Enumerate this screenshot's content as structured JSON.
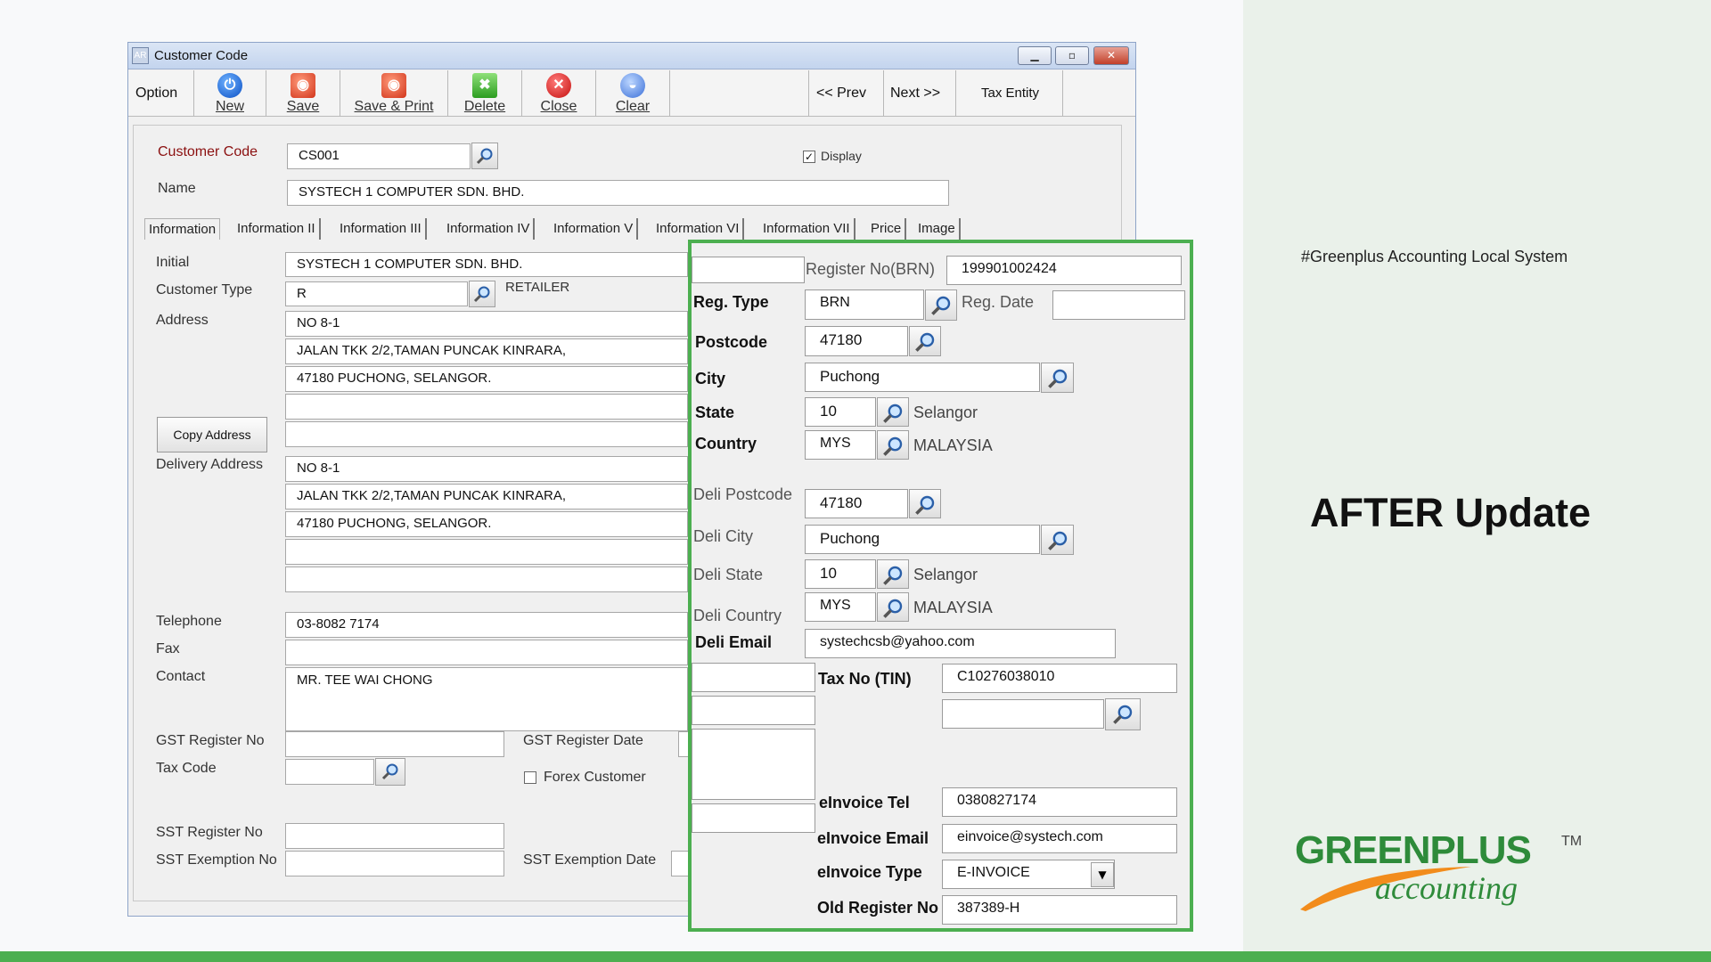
{
  "slide": {
    "hashtag": "#Greenplus Accounting Local System",
    "heading": "AFTER Update",
    "logo_main": "GREENPLUS",
    "logo_tm": "TM",
    "logo_sub": "accounting",
    "colors": {
      "accent": "#4caf50",
      "logo": "#2e8b3a",
      "panel": "#eaf1ea"
    }
  },
  "window": {
    "title": "Customer Code",
    "icon_text": "AR",
    "controls": [
      "minimize-icon",
      "maximize-icon",
      "close-icon"
    ]
  },
  "toolbar": {
    "option": "Option",
    "new": "New",
    "save": "Save",
    "save_print": "Save & Print",
    "delete": "Delete",
    "close": "Close",
    "clear": "Clear",
    "prev": "<<  Prev",
    "next": "Next  >>",
    "tax_entity": "Tax Entity"
  },
  "header": {
    "customer_code_label": "Customer Code",
    "customer_code": "CS001",
    "display_label": "Display",
    "display_checked": "✓",
    "name_label": "Name",
    "name": "SYSTECH 1 COMPUTER SDN. BHD."
  },
  "tabs": [
    "Information",
    "Information II",
    "Information III",
    "Information IV",
    "Information V",
    "Information VI",
    "Information VII",
    "Price",
    "Image"
  ],
  "info": {
    "initial_label": "Initial",
    "initial": "SYSTECH 1 COMPUTER SDN. BHD.",
    "customer_type_label": "Customer Type",
    "customer_type": "R",
    "customer_type_desc": "RETAILER",
    "address_label": "Address",
    "address": [
      "NO 8-1",
      "JALAN TKK 2/2,TAMAN PUNCAK KINRARA,",
      "47180 PUCHONG, SELANGOR.",
      "",
      ""
    ],
    "copy_address": "Copy Address",
    "delivery_address_label": "Delivery Address",
    "delivery_address": [
      "NO 8-1",
      "JALAN TKK 2/2,TAMAN PUNCAK KINRARA,",
      "47180 PUCHONG, SELANGOR.",
      "",
      ""
    ],
    "telephone_label": "Telephone",
    "telephone": "03-8082 7174",
    "fax_label": "Fax",
    "fax": "",
    "contact_label": "Contact",
    "contact": "MR. TEE WAI CHONG",
    "gst_reg_no_label": "GST Register No",
    "gst_reg_date_label": "GST Register Date",
    "tax_code_label": "Tax Code",
    "forex_label": "Forex Customer",
    "sst_reg_no_label": "SST Register No",
    "sst_exemption_no_label": "SST Exemption No",
    "sst_exemption_date_label": "SST Exemption Date"
  },
  "overlay": {
    "brn_label": "Register No(BRN)",
    "brn": "199901002424",
    "reg_type_label": "Reg. Type",
    "reg_type": "BRN",
    "reg_date_label": "Reg. Date",
    "reg_date": "",
    "postcode_label": "Postcode",
    "postcode": "47180",
    "city_label": "City",
    "city": "Puchong",
    "state_label": "State",
    "state_code": "10",
    "state_name": "Selangor",
    "country_label": "Country",
    "country_code": "MYS",
    "country_name": "MALAYSIA",
    "deli_postcode_label": "Deli Postcode",
    "deli_postcode": "47180",
    "deli_city_label": "Deli City",
    "deli_city": "Puchong",
    "deli_state_label": "Deli State",
    "deli_state_code": "10",
    "deli_state_name": "Selangor",
    "deli_country_label": "Deli Country",
    "deli_country_code": "MYS",
    "deli_country_name": "MALAYSIA",
    "deli_email_label": "Deli Email",
    "deli_email": "systechcsb@yahoo.com",
    "tin_label": "Tax No (TIN)",
    "tin": "C10276038010",
    "einvoice_tel_label": "eInvoice Tel",
    "einvoice_tel": "0380827174",
    "einvoice_email_label": "eInvoice Email",
    "einvoice_email": "einvoice@systech.com",
    "einvoice_type_label": "eInvoice Type",
    "einvoice_type": "E-INVOICE",
    "old_reg_label": "Old Register No",
    "old_reg": "387389-H"
  }
}
